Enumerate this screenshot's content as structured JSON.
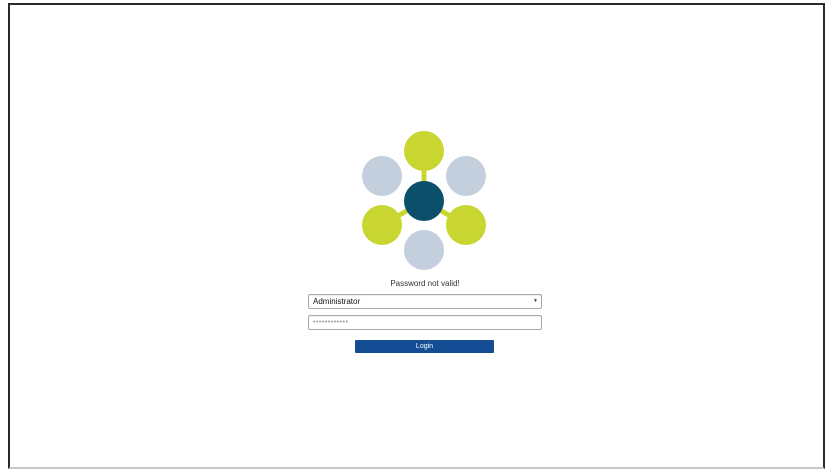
{
  "login": {
    "status_message": "Password not valid!",
    "user_select": {
      "selected_value": "Administrator",
      "caret_glyph": "▼"
    },
    "password": {
      "masked_value": "••••••••••••"
    },
    "login_button_label": "Login"
  },
  "logo": {
    "icon": "network-hub-logo",
    "colors": {
      "center": "#0b4f6b",
      "accent": "#c9d531",
      "muted": "#c3cfdc",
      "connector": "#c9d531"
    }
  }
}
